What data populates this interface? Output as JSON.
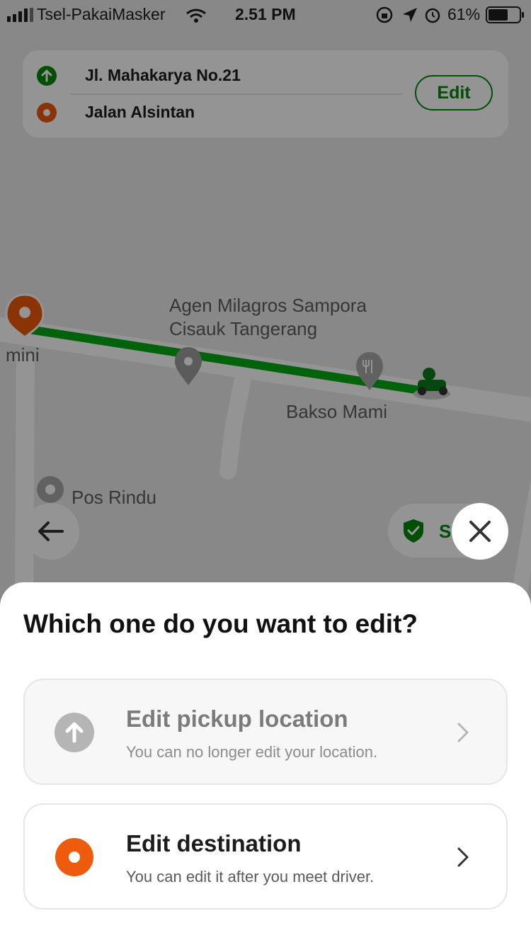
{
  "status_bar": {
    "carrier": "Tsel-PakaiMasker",
    "time": "2.51 PM",
    "battery": "61%"
  },
  "route_card": {
    "pickup": "Jl. Mahakarya No.21",
    "destination": "Jalan Alsintan",
    "edit_label": "Edit"
  },
  "map": {
    "labels": [
      "Agen Milagros Sampora",
      "Cisauk Tangerang",
      "Bakso Mami",
      "Pos Rindu",
      "mini"
    ],
    "route_color": "#00aa13"
  },
  "safety": {
    "label_partial": "S"
  },
  "sheet": {
    "title": "Which one do you want to edit?",
    "options": [
      {
        "title": "Edit pickup location",
        "subtitle": "You can no longer edit your location.",
        "icon": "arrow-up-circle-icon",
        "enabled": false
      },
      {
        "title": "Edit destination",
        "subtitle": "You can edit it after you meet driver.",
        "icon": "destination-dot-icon",
        "enabled": true
      }
    ]
  },
  "colors": {
    "brand_green": "#00880a",
    "destination_orange": "#ee5b0c"
  }
}
